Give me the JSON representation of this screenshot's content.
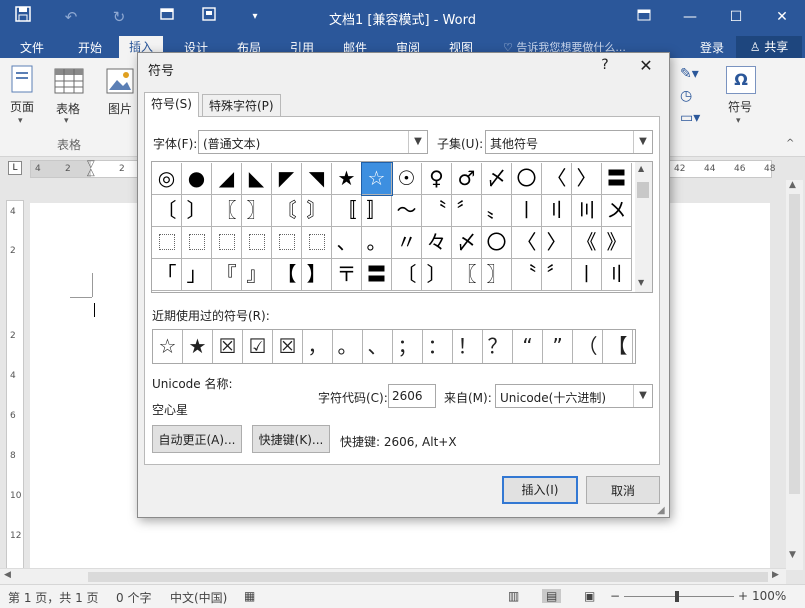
{
  "titlebar": {
    "title": "文档1 [兼容模式] - Word",
    "save_icon": "save-icon",
    "undo_icon": "undo-icon",
    "redo_icon": "redo-icon",
    "print_icon": "print-preview-icon",
    "customize_icon": "customize-qat-icon"
  },
  "window_buttons": {
    "restore_ribbon": "ribbon-display-icon",
    "minimize": "minimize-icon",
    "maximize": "maximize-icon",
    "close": "close-icon"
  },
  "tabs": [
    {
      "label": "文件"
    },
    {
      "label": "开始"
    },
    {
      "label": "插入"
    },
    {
      "label": "设计"
    },
    {
      "label": "布局"
    },
    {
      "label": "引用"
    },
    {
      "label": "邮件"
    },
    {
      "label": "审阅"
    },
    {
      "label": "视图"
    }
  ],
  "tell_me": "告诉我您想要做什么...",
  "login": "登录",
  "share": "共享",
  "ribbon": {
    "pages_label": "页面",
    "table_label": "表格",
    "group_table": "表格",
    "picture_label": "图片",
    "symbol_label": "符号"
  },
  "ruler_ticks": [
    "4",
    "2",
    "2",
    "42",
    "44",
    "46",
    "48"
  ],
  "vruler_ticks": [
    "4",
    "2",
    "2",
    "4",
    "6",
    "8",
    "10",
    "12"
  ],
  "statusbar": {
    "page": "第 1 页，共 1 页",
    "words": "0 个字",
    "language": "中文(中国)",
    "zoom": "100%"
  },
  "dialog": {
    "title": "符号",
    "help": "?",
    "tabs": [
      {
        "label": "符号(S)"
      },
      {
        "label": "特殊字符(P)"
      }
    ],
    "font_label": "字体(F):",
    "font_value": "(普通文本)",
    "subset_label": "子集(U):",
    "subset_value": "其他符号",
    "symbols": [
      [
        "◎",
        "●",
        "◢",
        "◣",
        "◤",
        "◥",
        "★",
        "☆",
        "☉",
        "♀",
        "♂",
        "〆",
        "〇",
        "〈",
        "〉",
        "〓"
      ],
      [
        "〔",
        "〕",
        "〖",
        "〗",
        "〘",
        "〙",
        "〚",
        "〛",
        "〜",
        "〝",
        "〞",
        "〟",
        "〡",
        "〢",
        "〣",
        "〤"
      ],
      [
        "",
        "",
        "",
        "",
        "",
        "",
        "、",
        "。",
        "〃",
        "々",
        "〆",
        "〇",
        "〈",
        "〉",
        "《",
        "》"
      ],
      [
        "「",
        "」",
        "『",
        "』",
        "【",
        "】",
        "〒",
        "〓",
        "〔",
        "〕",
        "〖",
        "〗",
        "〝",
        "〞",
        "〡",
        "〢"
      ]
    ],
    "recent_label": "近期使用过的符号(R):",
    "recent": [
      "☆",
      "★",
      "☒",
      "☑",
      "☒",
      "，",
      "。",
      "、",
      "；",
      "：",
      "！",
      "？",
      "“",
      "”",
      "（",
      "【"
    ],
    "unicode_name_label": "Unicode 名称:",
    "unicode_name_value": "空心星",
    "char_code_label": "字符代码(C):",
    "char_code_value": "2606",
    "from_label": "来自(M):",
    "from_value": "Unicode(十六进制)",
    "autocorrect_button": "自动更正(A)...",
    "shortcut_button": "快捷键(K)...",
    "shortcut_text": "快捷键: 2606, Alt+X",
    "insert_button": "插入(I)",
    "cancel_button": "取消"
  },
  "colors": {
    "accent": "#2b579a",
    "selection": "#3d8fe0"
  }
}
